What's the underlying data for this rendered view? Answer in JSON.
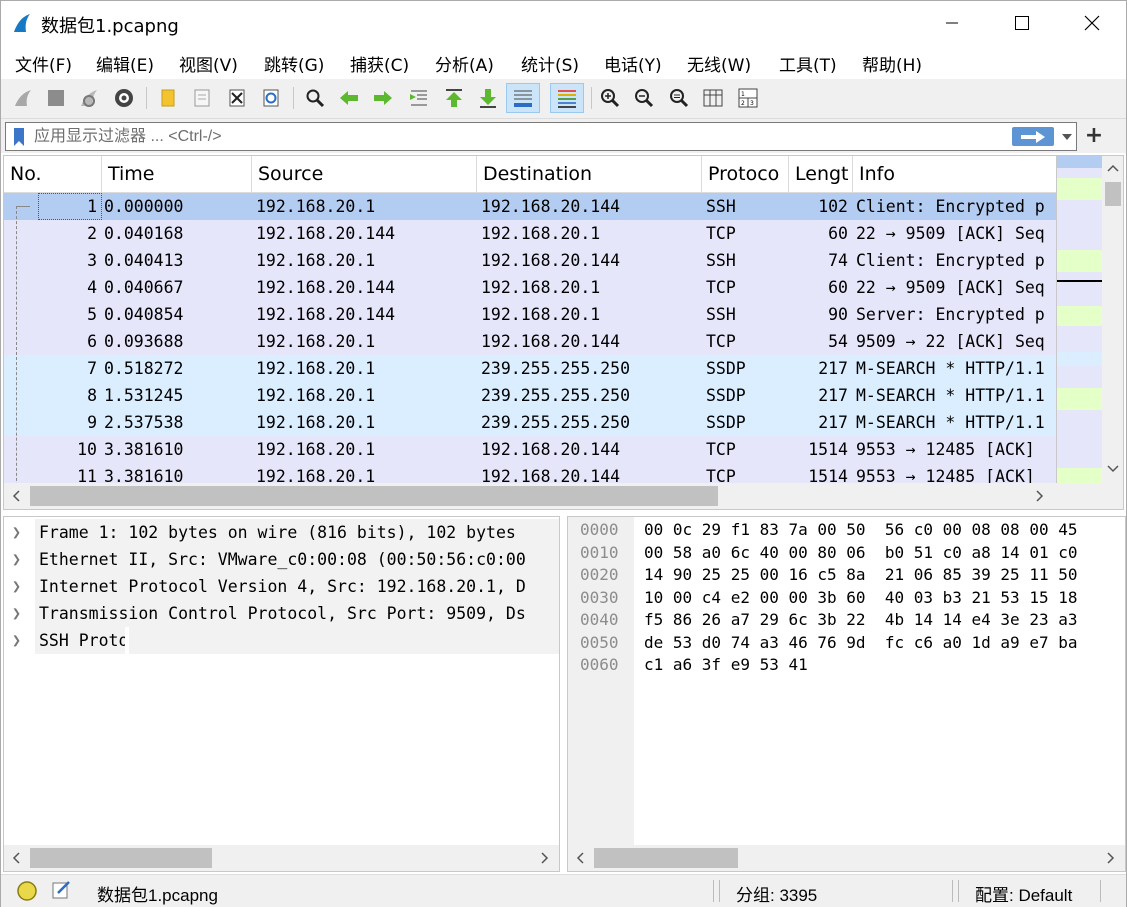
{
  "window": {
    "title": "数据包1.pcapng"
  },
  "menu": [
    "文件(F)",
    "编辑(E)",
    "视图(V)",
    "跳转(G)",
    "捕获(C)",
    "分析(A)",
    "统计(S)",
    "电话(Y)",
    "无线(W)",
    "工具(T)",
    "帮助(H)"
  ],
  "toolbar": {
    "icons": [
      "start-capture-icon",
      "stop-capture-icon",
      "restart-capture-icon",
      "capture-options-icon",
      "open-file-icon",
      "save-file-icon",
      "close-file-icon",
      "reload-file-icon",
      "find-packet-icon",
      "go-back-icon",
      "go-forward-icon",
      "go-to-packet-icon",
      "first-packet-icon",
      "last-packet-icon",
      "auto-scroll-icon",
      "colorize-icon",
      "zoom-in-icon",
      "zoom-out-icon",
      "normal-size-icon",
      "resize-columns-icon"
    ]
  },
  "filter": {
    "placeholder": "应用显示过滤器 ... <Ctrl-/>",
    "value": ""
  },
  "packet_list": {
    "columns": [
      "No.",
      "Time",
      "Source",
      "Destination",
      "Protoco",
      "Lengt",
      "Info"
    ],
    "rows": [
      {
        "no": "1",
        "time": "0.000000",
        "src": "192.168.20.1",
        "dst": "192.168.20.144",
        "proto": "SSH",
        "len": "102",
        "info": "Client: Encrypted p",
        "bg": "#b3cdf2"
      },
      {
        "no": "2",
        "time": "0.040168",
        "src": "192.168.20.144",
        "dst": "192.168.20.1",
        "proto": "TCP",
        "len": "60",
        "info": "22 → 9509 [ACK] Seq",
        "bg": "#e6e6fa"
      },
      {
        "no": "3",
        "time": "0.040413",
        "src": "192.168.20.1",
        "dst": "192.168.20.144",
        "proto": "SSH",
        "len": "74",
        "info": "Client: Encrypted p",
        "bg": "#e6e6fa"
      },
      {
        "no": "4",
        "time": "0.040667",
        "src": "192.168.20.144",
        "dst": "192.168.20.1",
        "proto": "TCP",
        "len": "60",
        "info": "22 → 9509 [ACK] Seq",
        "bg": "#e6e6fa"
      },
      {
        "no": "5",
        "time": "0.040854",
        "src": "192.168.20.144",
        "dst": "192.168.20.1",
        "proto": "SSH",
        "len": "90",
        "info": "Server: Encrypted p",
        "bg": "#e6e6fa"
      },
      {
        "no": "6",
        "time": "0.093688",
        "src": "192.168.20.1",
        "dst": "192.168.20.144",
        "proto": "TCP",
        "len": "54",
        "info": "9509 → 22 [ACK] Seq",
        "bg": "#e6e6fa"
      },
      {
        "no": "7",
        "time": "0.518272",
        "src": "192.168.20.1",
        "dst": "239.255.255.250",
        "proto": "SSDP",
        "len": "217",
        "info": "M-SEARCH * HTTP/1.1",
        "bg": "#daeeff"
      },
      {
        "no": "8",
        "time": "1.531245",
        "src": "192.168.20.1",
        "dst": "239.255.255.250",
        "proto": "SSDP",
        "len": "217",
        "info": "M-SEARCH * HTTP/1.1",
        "bg": "#daeeff"
      },
      {
        "no": "9",
        "time": "2.537538",
        "src": "192.168.20.1",
        "dst": "239.255.255.250",
        "proto": "SSDP",
        "len": "217",
        "info": "M-SEARCH * HTTP/1.1",
        "bg": "#daeeff"
      },
      {
        "no": "10",
        "time": "3.381610",
        "src": "192.168.20.1",
        "dst": "192.168.20.144",
        "proto": "TCP",
        "len": "1514",
        "info": "9553 → 12485 [ACK]",
        "bg": "#e6e6fa"
      },
      {
        "no": "11",
        "time": "3.381610",
        "src": "192.168.20.1",
        "dst": "192.168.20.144",
        "proto": "TCP",
        "len": "1514",
        "info": "9553 → 12485 [ACK]",
        "bg": "#e6e6fa"
      }
    ]
  },
  "details": [
    "Frame 1: 102 bytes on wire (816 bits), 102 bytes",
    "Ethernet II, Src: VMware_c0:00:08 (00:50:56:c0:00",
    "Internet Protocol Version 4, Src: 192.168.20.1, D",
    "Transmission Control Protocol, Src Port: 9509, Ds",
    "SSH Protocol"
  ],
  "hex": [
    {
      "offset": "0000",
      "bytes": "00 0c 29 f1 83 7a 00 50  56 c0 00 08 08 00 45"
    },
    {
      "offset": "0010",
      "bytes": "00 58 a0 6c 40 00 80 06  b0 51 c0 a8 14 01 c0"
    },
    {
      "offset": "0020",
      "bytes": "14 90 25 25 00 16 c5 8a  21 06 85 39 25 11 50"
    },
    {
      "offset": "0030",
      "bytes": "10 00 c4 e2 00 00 3b 60  40 03 b3 21 53 15 18"
    },
    {
      "offset": "0040",
      "bytes": "f5 86 26 a7 29 6c 3b 22  4b 14 14 e4 3e 23 a3"
    },
    {
      "offset": "0050",
      "bytes": "de 53 d0 74 a3 46 76 9d  fc c6 a0 1d a9 e7 ba"
    },
    {
      "offset": "0060",
      "bytes": "c1 a6 3f e9 53 41"
    }
  ],
  "status": {
    "file": "数据包1.pcapng",
    "packets": "分组: 3395",
    "profile": "配置: Default"
  },
  "colors": {
    "selected_row": "#b3cdf2",
    "tcp_row": "#e6e6fa",
    "udp_row": "#daeeff",
    "minimap_green": "#e4ffc7"
  }
}
